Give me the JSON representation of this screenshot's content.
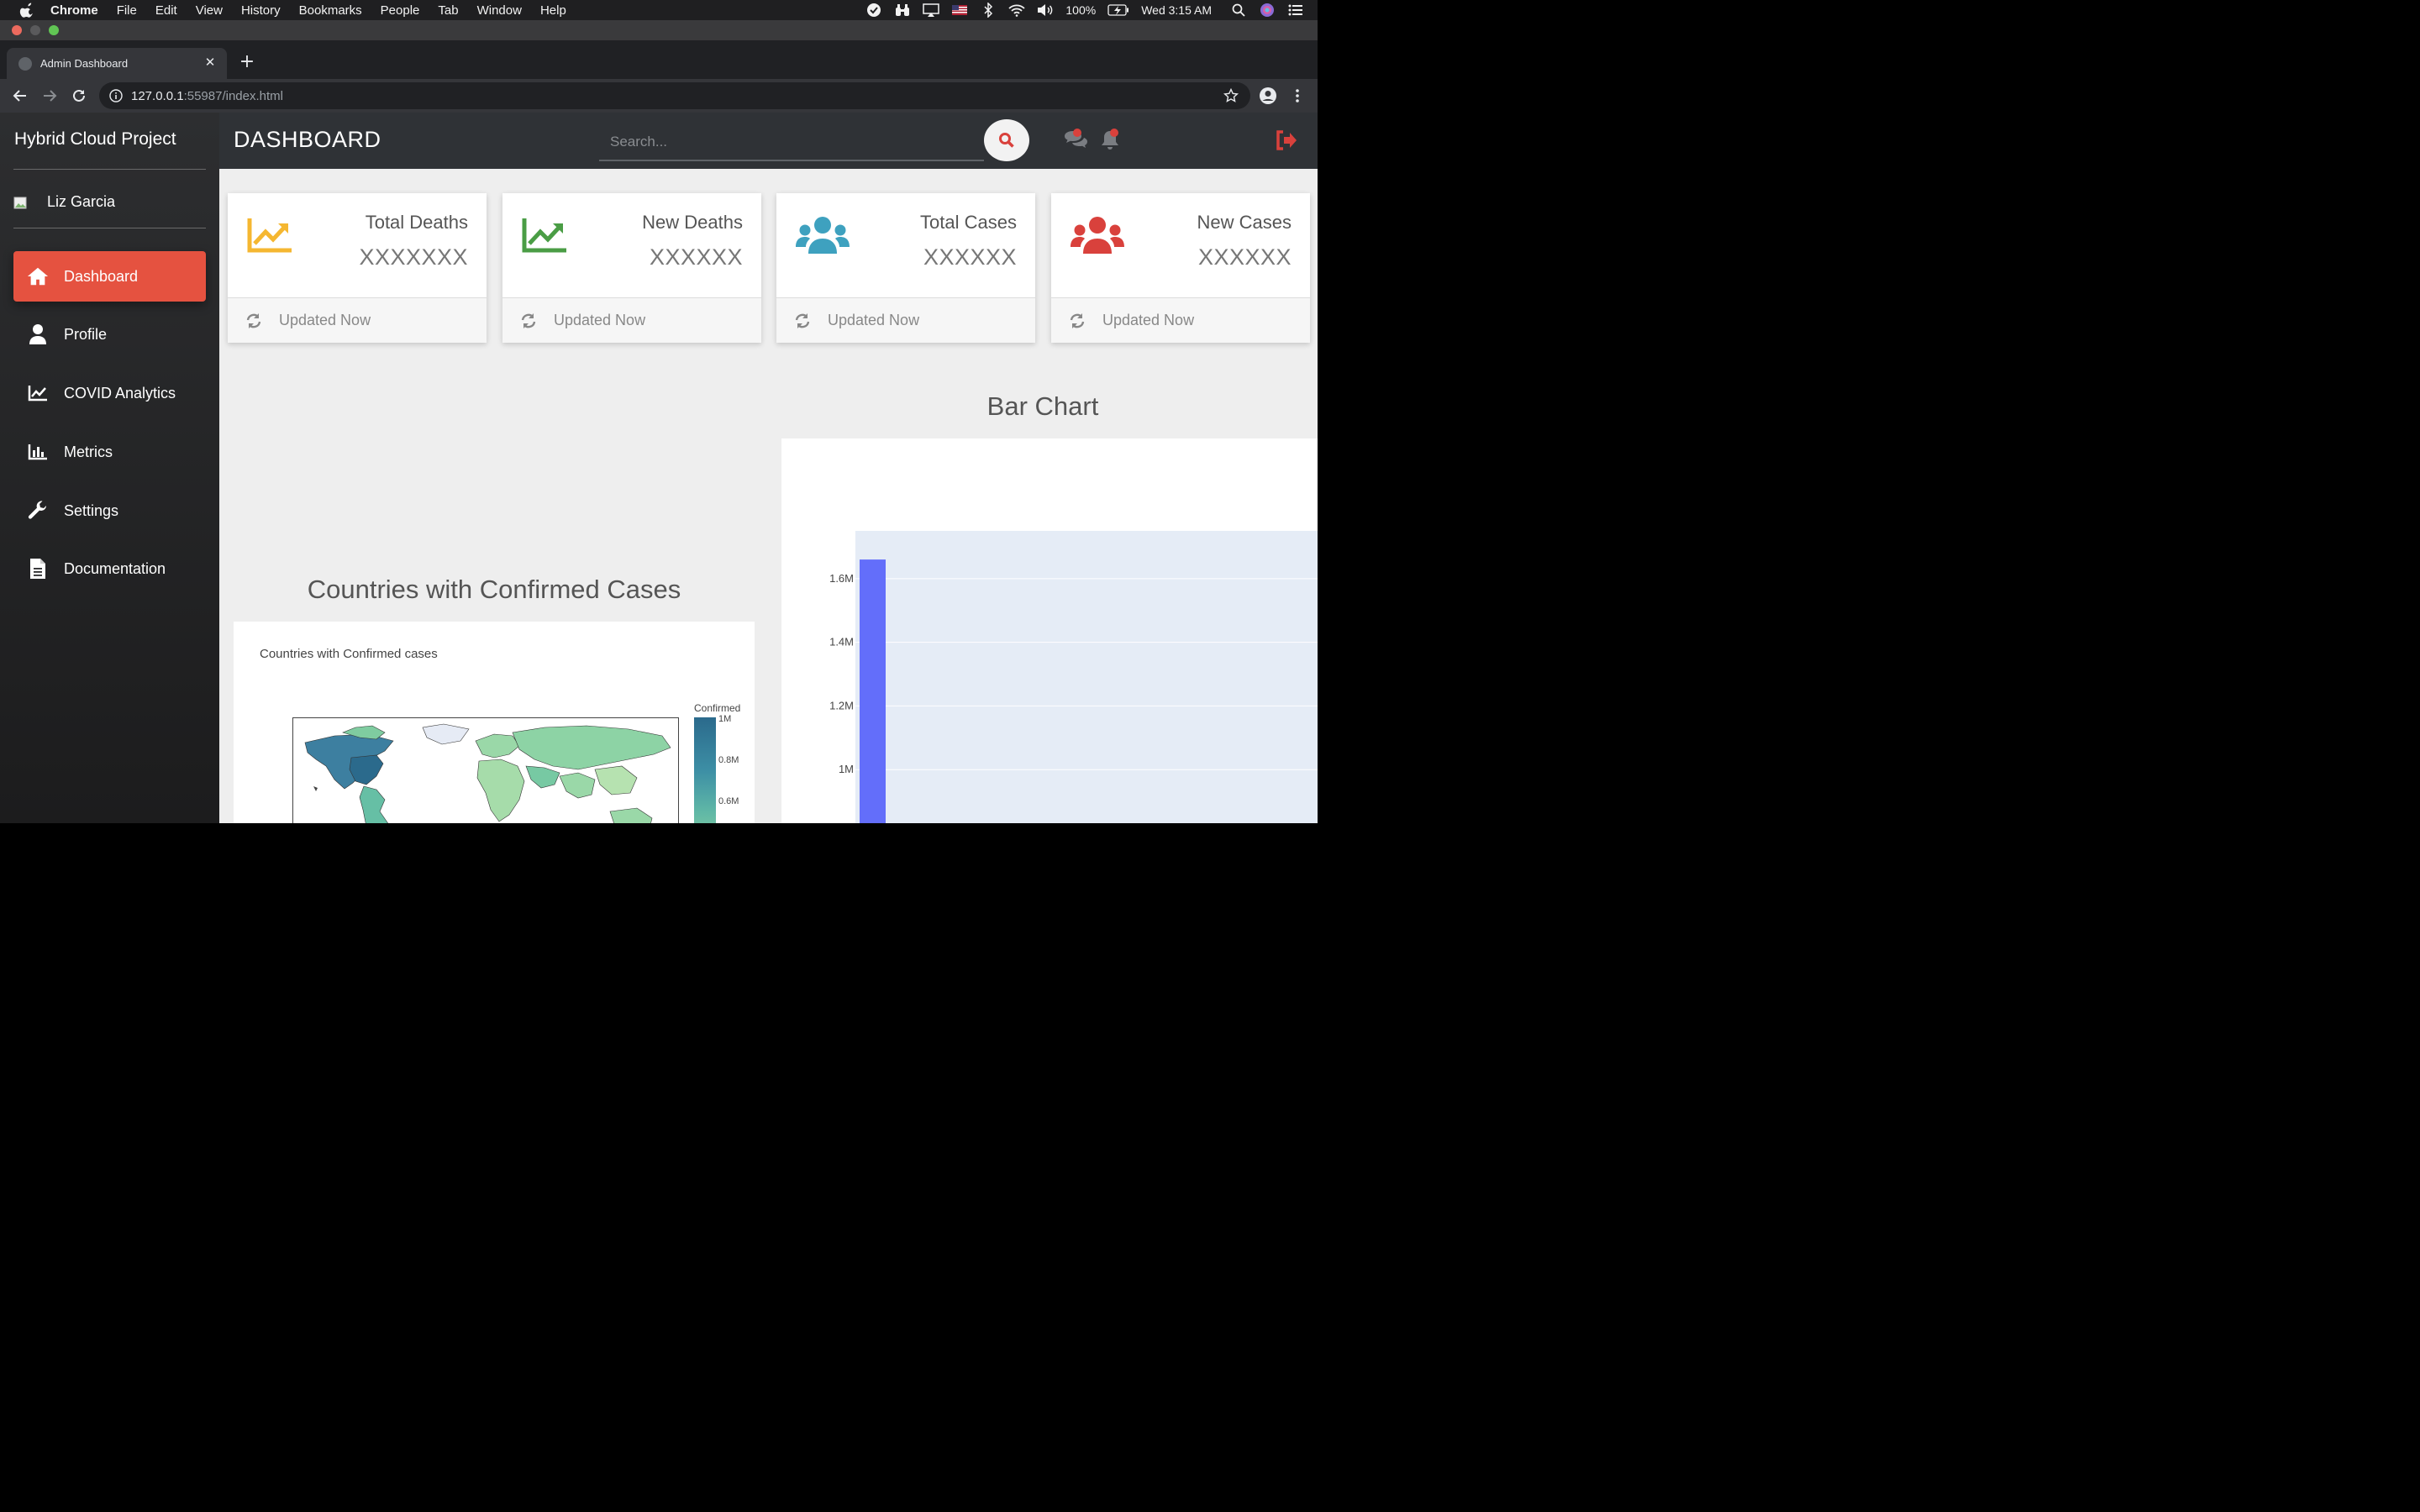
{
  "menubar": {
    "app_name": "Chrome",
    "items": [
      "File",
      "Edit",
      "View",
      "History",
      "Bookmarks",
      "People",
      "Tab",
      "Window",
      "Help"
    ],
    "battery": "100%",
    "clock": "Wed 3:15 AM"
  },
  "browser": {
    "tab_title": "Admin Dashboard",
    "url_host": "127.0.0.1",
    "url_path": ":55987/index.html"
  },
  "sidebar": {
    "brand": "Hybrid Cloud Project",
    "user_name": "Liz Garcia",
    "items": [
      {
        "label": "Dashboard",
        "icon": "home-icon",
        "active": true
      },
      {
        "label": "Profile",
        "icon": "user-icon",
        "active": false
      },
      {
        "label": "COVID Analytics",
        "icon": "line-chart-icon",
        "active": false
      },
      {
        "label": "Metrics",
        "icon": "bar-chart-icon",
        "active": false
      },
      {
        "label": "Settings",
        "icon": "wrench-icon",
        "active": false
      },
      {
        "label": "Documentation",
        "icon": "document-icon",
        "active": false
      }
    ]
  },
  "header": {
    "title": "DASHBOARD",
    "search_placeholder": "Search..."
  },
  "cards": [
    {
      "title": "Total Deaths",
      "value": "XXXXXXX",
      "footer": "Updated Now",
      "icon": "trend-up-icon",
      "color": "#f5b731"
    },
    {
      "title": "New Deaths",
      "value": "XXXXXX",
      "footer": "Updated Now",
      "icon": "trend-up-icon",
      "color": "#4a9d45"
    },
    {
      "title": "Total Cases",
      "value": "XXXXXX",
      "footer": "Updated Now",
      "icon": "users-icon",
      "color": "#3ea1bf"
    },
    {
      "title": "New Cases",
      "value": "XXXXXX",
      "footer": "Updated Now",
      "icon": "users-icon",
      "color": "#d9413c"
    }
  ],
  "map_section": {
    "heading": "Countries with Confirmed Cases",
    "plot_title": "Countries with Confirmed cases",
    "colorbar_title": "Confirmed",
    "colorbar_ticks": [
      "1M",
      "0.8M",
      "0.6M"
    ]
  },
  "chart_data": {
    "type": "bar",
    "title": "Bar Chart",
    "xlabel": "",
    "ylabel": "",
    "y_ticks": [
      "1M",
      "1.2M",
      "1.4M",
      "1.6M"
    ],
    "y_tick_values": [
      1000000,
      1200000,
      1400000,
      1600000
    ],
    "ylim": [
      800000,
      1750000
    ],
    "values": [
      1660000
    ],
    "bar_color": "#636efa",
    "grid": true
  },
  "colors": {
    "accent": "#e55240",
    "sidebar_bg": "#2d2e30",
    "topnav_bg": "#2f3236"
  }
}
